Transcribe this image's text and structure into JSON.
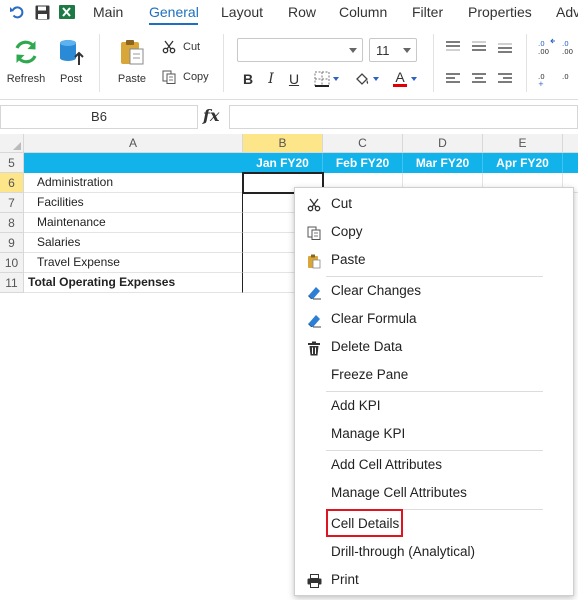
{
  "tabs": [
    {
      "label": "Main",
      "active": false
    },
    {
      "label": "General",
      "active": true
    },
    {
      "label": "Layout",
      "active": false
    },
    {
      "label": "Row",
      "active": false
    },
    {
      "label": "Column",
      "active": false
    },
    {
      "label": "Filter",
      "active": false
    },
    {
      "label": "Properties",
      "active": false
    },
    {
      "label": "Adv",
      "active": false
    }
  ],
  "quick_access": {
    "icons": [
      "undo-icon",
      "save-icon",
      "excel-icon"
    ]
  },
  "ribbon": {
    "refresh_label": "Refresh",
    "post_label": "Post",
    "paste_label": "Paste",
    "cut_label": "Cut",
    "copy_label": "Copy",
    "font_family_value": "",
    "font_size_value": "11",
    "bold": "B",
    "italic": "I",
    "underline": "U",
    "font_color_glyph": "A",
    "font_color": "#e00000"
  },
  "formula_bar": {
    "name_box": "B6",
    "fx": "fx",
    "formula": ""
  },
  "sheet": {
    "columns": [
      "A",
      "B",
      "C",
      "D",
      "E"
    ],
    "selected_column": "B",
    "rows": [
      "5",
      "6",
      "7",
      "8",
      "9",
      "10",
      "11"
    ],
    "selected_row": "6",
    "period_headers": [
      "Jan FY20",
      "Feb FY20",
      "Mar FY20",
      "Apr FY20"
    ],
    "accounts": [
      "Administration",
      "Facilities",
      "Maintenance",
      "Salaries",
      "Travel Expense",
      "Total Operating Expenses"
    ],
    "header_color": "#12b2ea",
    "selected_cell": "B6"
  },
  "context_menu": {
    "items": [
      {
        "label": "Cut",
        "icon": "scissors-icon"
      },
      {
        "label": "Copy",
        "icon": "copy-icon"
      },
      {
        "label": "Paste",
        "icon": "paste-icon"
      },
      {
        "label": "Clear Changes",
        "icon": "eraser-icon"
      },
      {
        "label": "Clear Formula",
        "icon": "eraser-icon"
      },
      {
        "label": "Delete Data",
        "icon": "trash-icon"
      },
      {
        "label": "Freeze Pane",
        "icon": ""
      },
      {
        "label": "Add KPI",
        "icon": ""
      },
      {
        "label": "Manage KPI",
        "icon": ""
      },
      {
        "label": "Add Cell Attributes",
        "icon": ""
      },
      {
        "label": "Manage Cell Attributes",
        "icon": ""
      },
      {
        "label": "Cell Details",
        "icon": "",
        "highlighted": true
      },
      {
        "label": "Drill-through (Analytical)",
        "icon": ""
      },
      {
        "label": "Print",
        "icon": "printer-icon"
      }
    ],
    "highlight_color": "#e0141e"
  }
}
